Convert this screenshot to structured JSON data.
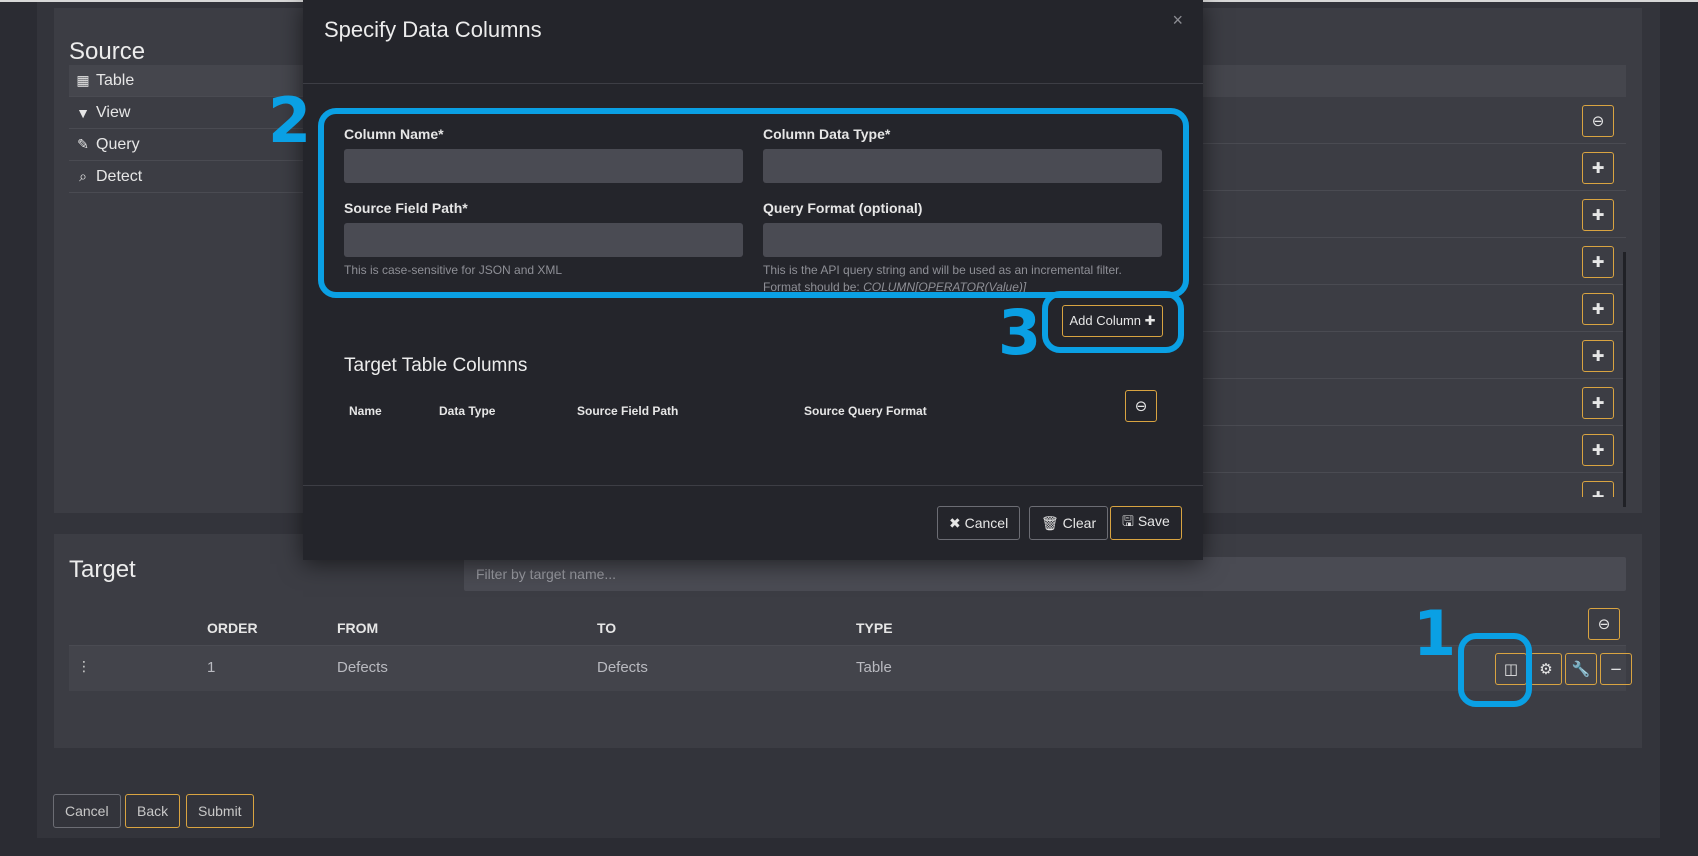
{
  "source": {
    "title": "Source",
    "nav": [
      {
        "label": "Table",
        "icon": "table-icon",
        "glyph": "▦"
      },
      {
        "label": "View",
        "icon": "filter-icon",
        "glyph": "▼"
      },
      {
        "label": "Query",
        "icon": "edit-icon",
        "glyph": "✎"
      },
      {
        "label": "Detect",
        "icon": "search-icon",
        "glyph": "⌕"
      }
    ],
    "row_count": 8
  },
  "target": {
    "title": "Target",
    "filter_placeholder": "Filter by target name...",
    "columns": [
      "ORDER",
      "FROM",
      "TO",
      "TYPE"
    ],
    "rows": [
      {
        "order": "1",
        "from": "Defects",
        "to": "Defects",
        "type": "Table"
      }
    ]
  },
  "footer": {
    "cancel": "Cancel",
    "back": "Back",
    "submit": "Submit"
  },
  "modal": {
    "title": "Specify Data Columns",
    "close": "×",
    "fields": {
      "column_name_label": "Column Name*",
      "column_type_label": "Column Data Type*",
      "source_path_label": "Source Field Path*",
      "query_format_label": "Query Format (optional)",
      "source_path_help": "This is case-sensitive for JSON and XML",
      "query_format_help_1": "This is the API query string and will be used as an incremental filter.",
      "query_format_help_2": "Format should be: ",
      "query_format_help_3": "COLUMN[OPERATOR(Value)]"
    },
    "add_column": "Add Column ✚",
    "target_columns_title": "Target Table Columns",
    "table_headers": [
      "Name",
      "Data Type",
      "Source Field Path",
      "Source Query Format"
    ],
    "buttons": {
      "cancel": "✖ Cancel",
      "clear": "🗑 Clear",
      "save": "🖫 Save"
    }
  },
  "annotations": {
    "one": "1",
    "two": "2",
    "three": "3",
    "color": "#0aa0e4"
  },
  "colors": {
    "accent": "#d9a441",
    "background": "#2b2c33",
    "modal": "#24252b"
  }
}
